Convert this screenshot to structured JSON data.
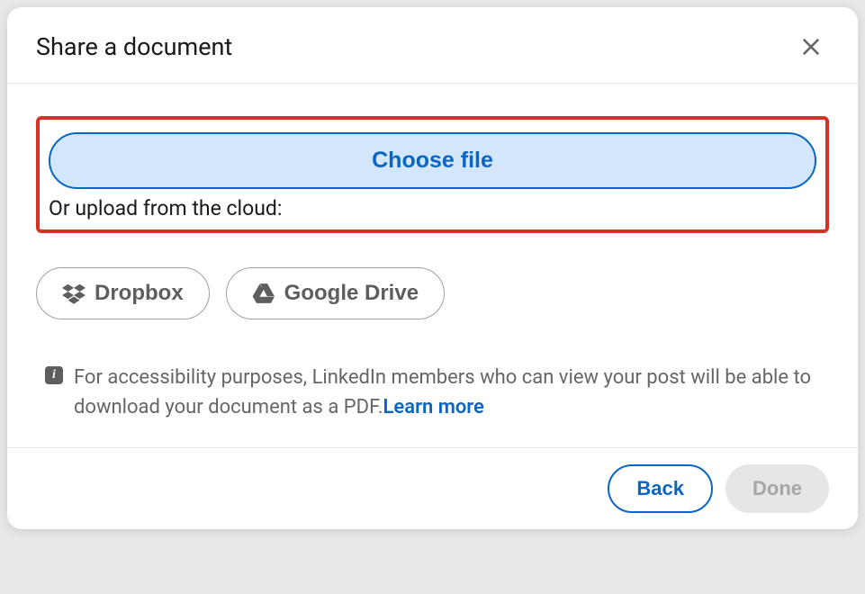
{
  "header": {
    "title": "Share a document"
  },
  "upload": {
    "choose_file_label": "Choose file",
    "cloud_label": "Or upload from the cloud:"
  },
  "cloud_providers": {
    "dropbox_label": "Dropbox",
    "gdrive_label": "Google Drive"
  },
  "info": {
    "text": "For accessibility purposes, LinkedIn members who can view your post will be able to download your document as a PDF.",
    "learn_more_label": "Learn more"
  },
  "footer": {
    "back_label": "Back",
    "done_label": "Done"
  }
}
